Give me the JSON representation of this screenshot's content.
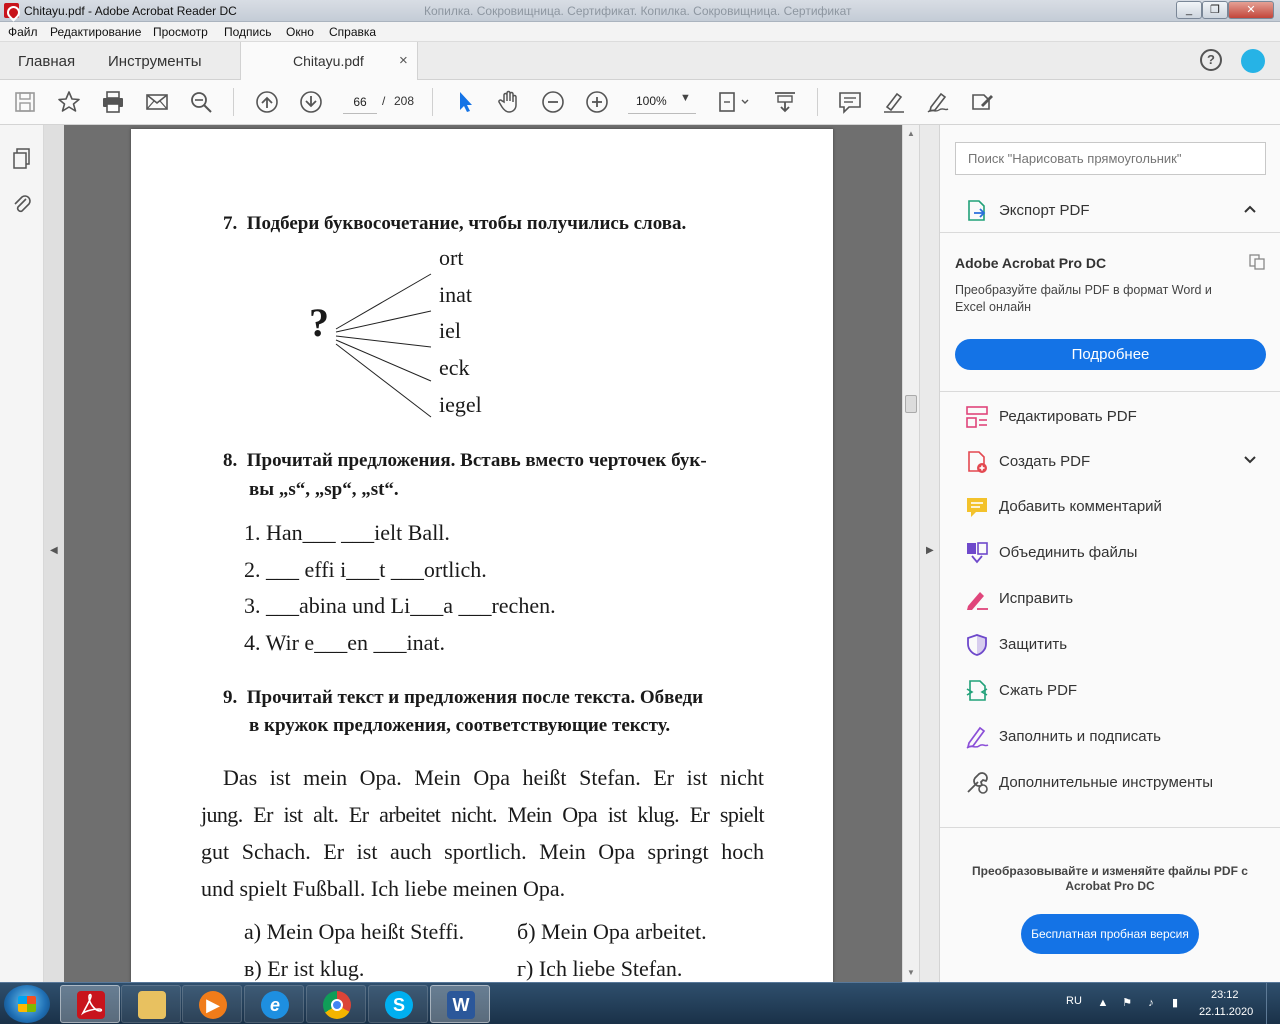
{
  "window": {
    "title": "Chitayu.pdf - Adobe Acrobat Reader DC",
    "ghost_title": "Копилка. Сокровищница. Сертификат. Копилка. Сокровищница. Сертификат"
  },
  "menu": [
    "Файл",
    "Редактирование",
    "Просмотр",
    "Подпись",
    "Окно",
    "Справка"
  ],
  "tabs": {
    "home": "Главная",
    "tools": "Инструменты",
    "document": "Chitayu.pdf",
    "close": "×"
  },
  "toolbar": {
    "page_current": "66",
    "page_separator": "/",
    "page_total": "208",
    "zoom": "100%"
  },
  "document": {
    "ex7": {
      "number": "7.",
      "heading": "Подбери буквосочетание, чтобы получились слова.",
      "question": "?",
      "endings": [
        "ort",
        "inat",
        "iel",
        "eck",
        "iegel"
      ]
    },
    "ex8": {
      "number": "8.",
      "heading_line1": "Прочитай предложения. Вставь вместо черточек бук-",
      "heading_line2": "вы „s“, „sp“, „st“.",
      "items": [
        "1. Han___ ___ielt Ball.",
        "2. ___ effi i___t ___ortlich.",
        "3. ___abina und Li___a ___rechen.",
        "4. Wir e___en ___inat."
      ]
    },
    "ex9": {
      "number": "9.",
      "heading_line1": "Прочитай текст и предложения после текста. Обведи",
      "heading_line2": "в кружок предложения, соответствующие тексту.",
      "text_lines": [
        "Das ist mein Opa. Mein Opa heißt Stefan. Er ist nicht",
        "jung. Er ist alt. Er arbeitet nicht. Mein Opa ist klug. Er spielt",
        "gut Schach. Er ist auch sportlich. Mein Opa springt hoch",
        "und spielt Fußball. Ich liebe meinen Opa."
      ],
      "options": {
        "a": "а) Mein Opa heißt Steffi.",
        "b": "б) Mein Opa arbeitet.",
        "v": "в) Er ist klug.",
        "g": "г) Ich liebe Stefan."
      }
    }
  },
  "right_panel": {
    "search_placeholder": "Поиск \"Нарисовать прямоугольник\"",
    "export_pdf": "Экспорт PDF",
    "promo_title": "Adobe Acrobat Pro DC",
    "promo_text": "Преобразуйте файлы PDF в формат Word и Excel онлайн",
    "promo_button": "Подробнее",
    "tools": [
      "Редактировать PDF",
      "Создать PDF",
      "Добавить комментарий",
      "Объединить файлы",
      "Исправить",
      "Защитить",
      "Сжать PDF",
      "Заполнить и подписать",
      "Дополнительные инструменты"
    ],
    "trial_text": "Преобразовывайте и изменяйте файлы PDF с Acrobat Pro DC",
    "trial_button": "Бесплатная пробная версия"
  },
  "taskbar": {
    "lang": "RU",
    "time": "23:12",
    "date": "22.11.2020",
    "skype_glyph": "S",
    "word_glyph": "W"
  },
  "colors": {
    "accent": "#1473e6",
    "acrobat_red": "#c8141c",
    "page_bg": "#6f6f6f"
  },
  "icons": [
    "save-icon",
    "bookmark-star-icon",
    "print-icon",
    "email-icon",
    "zoom-search-icon",
    "page-up-icon",
    "page-down-icon",
    "select-arrow-icon",
    "hand-tool-icon",
    "zoom-out-icon",
    "zoom-in-icon",
    "fit-page-icon",
    "scroll-mode-icon",
    "comment-icon",
    "highlight-icon",
    "sign-icon",
    "fill-sign-icon"
  ]
}
